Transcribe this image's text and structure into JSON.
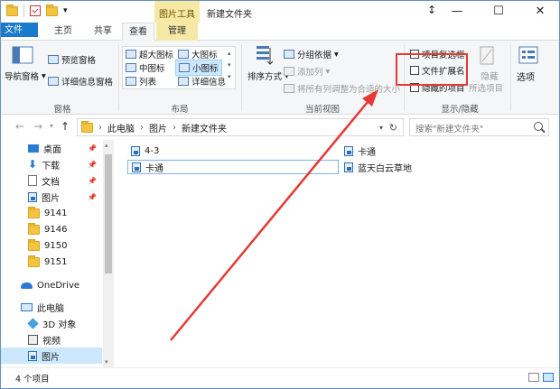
{
  "titlebar": {
    "context_tab": "图片工具",
    "title": "新建文件夹",
    "qat_dropdown": "▾"
  },
  "tabs": [
    {
      "label": "文件"
    },
    {
      "label": "主页"
    },
    {
      "label": "共享"
    },
    {
      "label": "查看"
    },
    {
      "label": "管理"
    }
  ],
  "ribbon": {
    "pane": {
      "nav_pane": "导航窗格",
      "preview": "预览窗格",
      "details": "详细信息窗格",
      "group": "窗格"
    },
    "layout": {
      "xl_icons": "超大图标",
      "large_icons": "大图标",
      "medium_icons": "中图标",
      "small_icons": "小图标",
      "list": "列表",
      "details": "详细信息",
      "group": "布局"
    },
    "current_view": {
      "sort": "排序方式",
      "group_by": "分组依据",
      "add_col": "添加列",
      "fit_cols": "将所有列调整为合适的大小",
      "group": "当前视图"
    },
    "show_hide": {
      "item_checkboxes": "项目复选框",
      "file_ext": "文件扩展名",
      "hidden_items": "隐藏的项目",
      "hide": "隐藏",
      "hide_selected": "所选项目",
      "group": "显示/隐藏"
    },
    "options": "选项"
  },
  "address": {
    "crumbs": [
      "此电脑",
      "图片",
      "新建文件夹"
    ],
    "search_placeholder": "搜索\"新建文件夹\""
  },
  "nav_pane": {
    "items": [
      {
        "label": "桌面"
      },
      {
        "label": "下载"
      },
      {
        "label": "文档"
      },
      {
        "label": "图片"
      },
      {
        "label": "9141"
      },
      {
        "label": "9146"
      },
      {
        "label": "9150"
      },
      {
        "label": "9151"
      },
      {
        "label": "OneDrive"
      },
      {
        "label": "此电脑"
      },
      {
        "label": "3D 对象"
      },
      {
        "label": "视频"
      },
      {
        "label": "图片"
      }
    ]
  },
  "files": [
    {
      "name": "4-3"
    },
    {
      "name": "卡通"
    },
    {
      "name": "卡通"
    },
    {
      "name": "蓝天白云草地"
    }
  ],
  "status": {
    "count": "4 个项目"
  },
  "colors": {
    "file_tab": "#1979ca",
    "context_tab": "#f6e9a6",
    "selection": "#cce8ff",
    "annotation": "#e53935"
  }
}
